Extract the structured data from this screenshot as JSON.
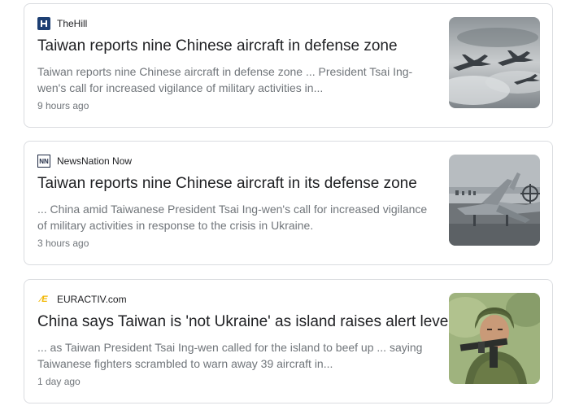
{
  "articles": [
    {
      "source": "TheHill",
      "source_icon": "thehill-logo-icon",
      "title": "Taiwan reports nine Chinese aircraft in defense zone",
      "snippet": "Taiwan reports nine Chinese aircraft in defense zone ... President Tsai Ing-wen's call for increased vigilance of military activities in...",
      "time": "9 hours ago",
      "thumbnail": "fighter-jets-in-cloudy-sky"
    },
    {
      "source": "NewsNation Now",
      "source_icon": "newsnation-logo-icon",
      "title": "Taiwan reports nine Chinese aircraft in its defense zone",
      "snippet": "... China amid Taiwanese President Tsai Ing-wen's call for increased vigilance of military activities in response to the crisis in Ukraine.",
      "time": "3 hours ago",
      "thumbnail": "military-aircraft-on-airfield"
    },
    {
      "source": "EURACTIV.com",
      "source_icon": "euractiv-logo-icon",
      "title": "China says Taiwan is 'not Ukraine' as island raises alert level",
      "snippet": "... as Taiwan President Tsai Ing-wen called for the island to beef up ... saying Taiwanese fighters scrambled to warn away 39 aircraft in...",
      "time": "1 day ago",
      "thumbnail": "soldier-with-rifle-and-helmet"
    }
  ]
}
